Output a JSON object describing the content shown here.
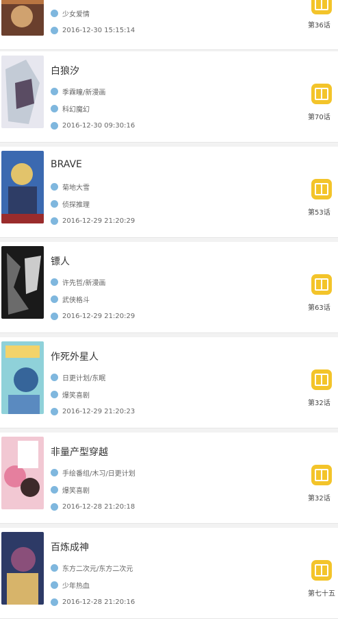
{
  "items": [
    {
      "title": "",
      "author": "",
      "genre": "少女爱情",
      "date": "2016-12-30 15:15:14",
      "episode": "第36话",
      "cover_colors": [
        "#b97542",
        "#6a3f2d",
        "#d0a26f"
      ]
    },
    {
      "title": "白狼汐",
      "author": "季霖瞳/新漫画",
      "genre": "科幻魔幻",
      "date": "2016-12-30 09:30:16",
      "episode": "第70话",
      "cover_colors": [
        "#c3cbd6",
        "#5a4c63",
        "#e7e7ef"
      ]
    },
    {
      "title": "BRAVE",
      "author": "菊地大雪",
      "genre": "侦探推理",
      "date": "2016-12-29 21:20:29",
      "episode": "第53话",
      "cover_colors": [
        "#3b69b0",
        "#e2c36b",
        "#9a2c2c"
      ]
    },
    {
      "title": "镖人",
      "author": "许先哲/新漫画",
      "genre": "武侠格斗",
      "date": "2016-12-29 21:20:29",
      "episode": "第63话",
      "cover_colors": [
        "#1a1a1a",
        "#6b6b6b",
        "#ccc"
      ]
    },
    {
      "title": "作死外星人",
      "author": "日更计划/东眠",
      "genre": "爆笑喜剧",
      "date": "2016-12-29 21:20:23",
      "episode": "第32话",
      "cover_colors": [
        "#8fd1d9",
        "#f3d36a",
        "#36659a"
      ]
    },
    {
      "title": "非量产型穿越",
      "author": "手绘番组/木习/日更计划",
      "genre": "爆笑喜剧",
      "date": "2016-12-28 21:20:18",
      "episode": "第32话",
      "cover_colors": [
        "#f2c8d3",
        "#e57f9e",
        "#3d2a2a"
      ]
    },
    {
      "title": "百炼成神",
      "author": "东方二次元/东方二次元",
      "genre": "少年热血",
      "date": "2016-12-28 21:20:16",
      "episode": "第七十五",
      "cover_colors": [
        "#2d3a66",
        "#8a4f7a",
        "#d7b46a"
      ]
    }
  ]
}
